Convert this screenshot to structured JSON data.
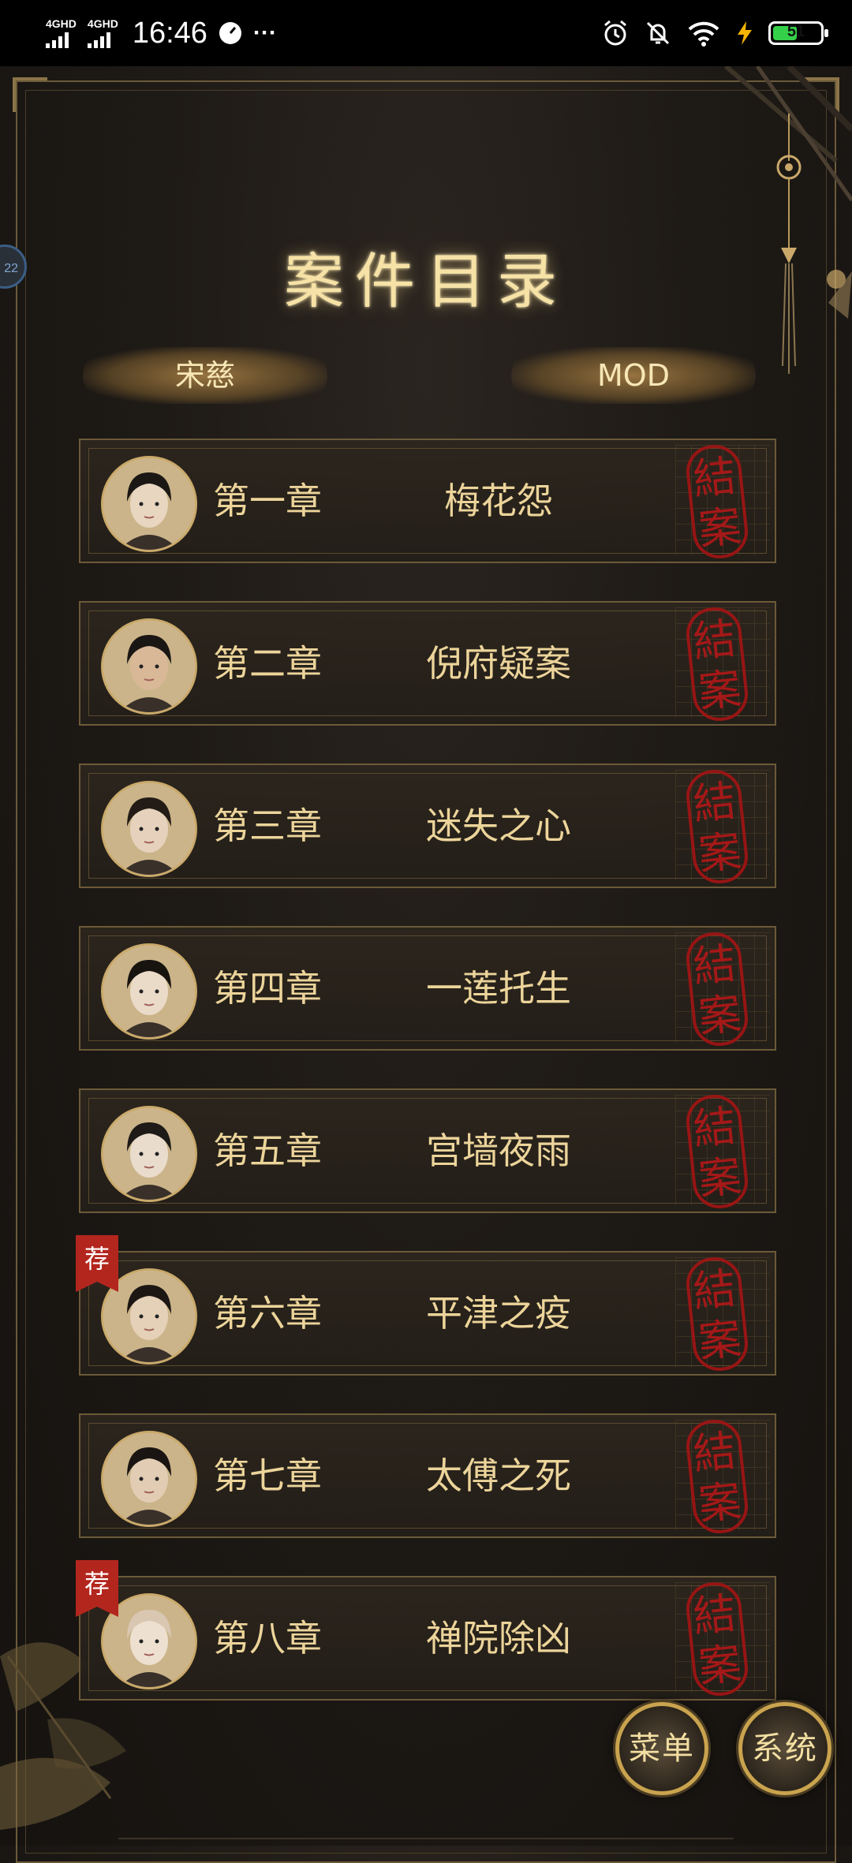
{
  "status_bar": {
    "sim1": "4GHD",
    "sim2": "4GHD",
    "time": "16:46",
    "more": "···",
    "battery_level": "51",
    "battery_fraction": 0.51
  },
  "side_tab": {
    "label": "22"
  },
  "title": "案件目录",
  "tabs": [
    {
      "label": "宋慈"
    },
    {
      "label": "MOD"
    }
  ],
  "chapters": [
    {
      "number": "第一章",
      "name": "梅花怨",
      "seal": [
        "結",
        "案"
      ],
      "recommended": false
    },
    {
      "number": "第二章",
      "name": "倪府疑案",
      "seal": [
        "結",
        "案"
      ],
      "recommended": false
    },
    {
      "number": "第三章",
      "name": "迷失之心",
      "seal": [
        "結",
        "案"
      ],
      "recommended": false
    },
    {
      "number": "第四章",
      "name": "一莲托生",
      "seal": [
        "結",
        "案"
      ],
      "recommended": false
    },
    {
      "number": "第五章",
      "name": "宫墙夜雨",
      "seal": [
        "結",
        "案"
      ],
      "recommended": false
    },
    {
      "number": "第六章",
      "name": "平津之疫",
      "seal": [
        "結",
        "案"
      ],
      "recommended": true,
      "badge": "荐"
    },
    {
      "number": "第七章",
      "name": "太傅之死",
      "seal": [
        "結",
        "案"
      ],
      "recommended": false
    },
    {
      "number": "第八章",
      "name": "禅院除凶",
      "seal": [
        "結",
        "案"
      ],
      "recommended": true,
      "badge": "荐"
    }
  ],
  "buttons": {
    "menu": "菜单",
    "system": "系统"
  },
  "colors": {
    "accent_gold": "#ecd49a",
    "seal_red": "#b01818",
    "badge_red": "#b3261e",
    "background": "#1e1a16"
  }
}
